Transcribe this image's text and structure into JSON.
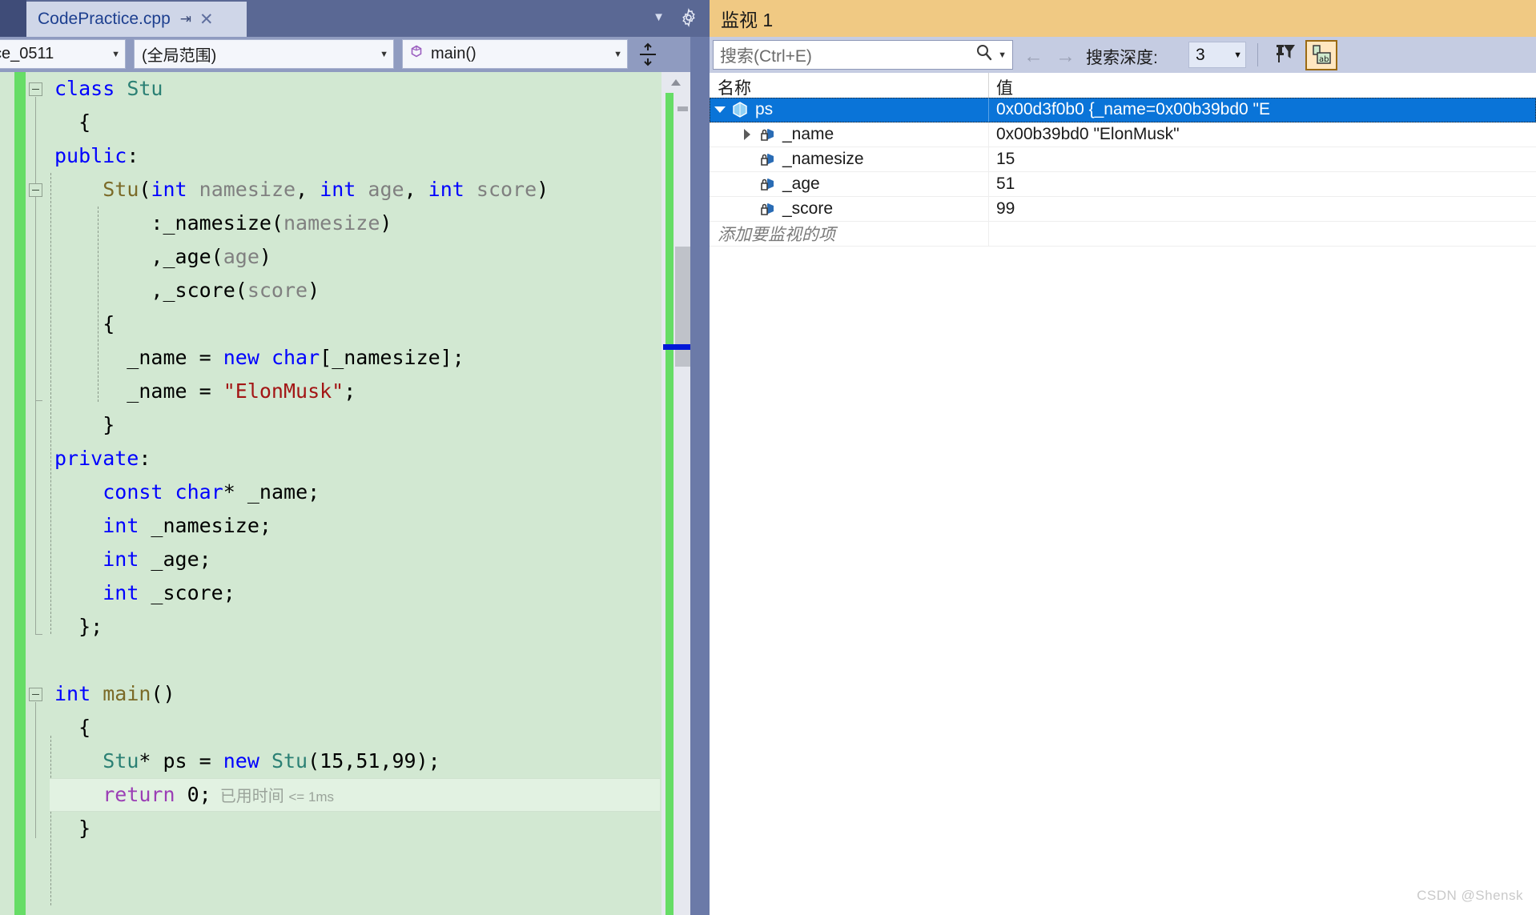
{
  "editor": {
    "tab": {
      "title": "CodePractice.cpp",
      "pin_icon": "pin-icon",
      "close_icon": "close-icon",
      "overflow_icon": "chevron-down-icon",
      "gear_icon": "gear-icon"
    },
    "navbar": {
      "project": "ce_0511",
      "scope": "(全局范围)",
      "member": "main()",
      "member_icon": "method-icon",
      "splitter_icon": "split-window-icon",
      "dropdown_arrow": "▾"
    },
    "code_lines": [
      {
        "tokens": [
          {
            "t": "class ",
            "c": "kw"
          },
          {
            "t": "Stu",
            "c": "type"
          }
        ]
      },
      {
        "tokens": [
          {
            "t": "  {",
            "c": "num"
          }
        ]
      },
      {
        "tokens": [
          {
            "t": "public",
            "c": "kw"
          },
          {
            "t": ":",
            "c": "num"
          }
        ]
      },
      {
        "tokens": [
          {
            "t": "    ",
            "c": "num"
          },
          {
            "t": "Stu",
            "c": "fn"
          },
          {
            "t": "(",
            "c": "num"
          },
          {
            "t": "int",
            "c": "kw"
          },
          {
            "t": " ",
            "c": "num"
          },
          {
            "t": "namesize",
            "c": "param"
          },
          {
            "t": ", ",
            "c": "num"
          },
          {
            "t": "int",
            "c": "kw"
          },
          {
            "t": " ",
            "c": "num"
          },
          {
            "t": "age",
            "c": "param"
          },
          {
            "t": ", ",
            "c": "num"
          },
          {
            "t": "int",
            "c": "kw"
          },
          {
            "t": " ",
            "c": "num"
          },
          {
            "t": "score",
            "c": "param"
          },
          {
            "t": ")",
            "c": "num"
          }
        ]
      },
      {
        "tokens": [
          {
            "t": "        :_namesize(",
            "c": "num"
          },
          {
            "t": "namesize",
            "c": "param"
          },
          {
            "t": ")",
            "c": "num"
          }
        ]
      },
      {
        "tokens": [
          {
            "t": "        ,_age(",
            "c": "num"
          },
          {
            "t": "age",
            "c": "param"
          },
          {
            "t": ")",
            "c": "num"
          }
        ]
      },
      {
        "tokens": [
          {
            "t": "        ,_score(",
            "c": "num"
          },
          {
            "t": "score",
            "c": "param"
          },
          {
            "t": ")",
            "c": "num"
          }
        ]
      },
      {
        "tokens": [
          {
            "t": "    {",
            "c": "num"
          }
        ]
      },
      {
        "tokens": [
          {
            "t": "      _name = ",
            "c": "num"
          },
          {
            "t": "new",
            "c": "kw"
          },
          {
            "t": " ",
            "c": "num"
          },
          {
            "t": "char",
            "c": "kw"
          },
          {
            "t": "[_namesize];",
            "c": "num"
          }
        ]
      },
      {
        "tokens": [
          {
            "t": "      _name = ",
            "c": "num"
          },
          {
            "t": "\"ElonMusk\"",
            "c": "str"
          },
          {
            "t": ";",
            "c": "num"
          }
        ]
      },
      {
        "tokens": [
          {
            "t": "    }",
            "c": "num"
          }
        ]
      },
      {
        "tokens": [
          {
            "t": "private",
            "c": "kw"
          },
          {
            "t": ":",
            "c": "num"
          }
        ]
      },
      {
        "tokens": [
          {
            "t": "    ",
            "c": "num"
          },
          {
            "t": "const",
            "c": "kw"
          },
          {
            "t": " ",
            "c": "num"
          },
          {
            "t": "char",
            "c": "kw"
          },
          {
            "t": "* _name;",
            "c": "num"
          }
        ]
      },
      {
        "tokens": [
          {
            "t": "    ",
            "c": "num"
          },
          {
            "t": "int",
            "c": "kw"
          },
          {
            "t": " _namesize;",
            "c": "num"
          }
        ]
      },
      {
        "tokens": [
          {
            "t": "    ",
            "c": "num"
          },
          {
            "t": "int",
            "c": "kw"
          },
          {
            "t": " _age;",
            "c": "num"
          }
        ]
      },
      {
        "tokens": [
          {
            "t": "    ",
            "c": "num"
          },
          {
            "t": "int",
            "c": "kw"
          },
          {
            "t": " _score;",
            "c": "num"
          }
        ]
      },
      {
        "tokens": [
          {
            "t": "  };",
            "c": "num"
          }
        ]
      },
      {
        "tokens": []
      },
      {
        "tokens": [
          {
            "t": "int",
            "c": "kw"
          },
          {
            "t": " ",
            "c": "num"
          },
          {
            "t": "main",
            "c": "fn"
          },
          {
            "t": "()",
            "c": "num"
          }
        ]
      },
      {
        "tokens": [
          {
            "t": "  {",
            "c": "num"
          }
        ]
      },
      {
        "tokens": [
          {
            "t": "    ",
            "c": "num"
          },
          {
            "t": "Stu",
            "c": "type"
          },
          {
            "t": "* ps = ",
            "c": "num"
          },
          {
            "t": "new",
            "c": "kw"
          },
          {
            "t": " ",
            "c": "num"
          },
          {
            "t": "Stu",
            "c": "type"
          },
          {
            "t": "(15,51,99);",
            "c": "num"
          }
        ]
      },
      {
        "current": true,
        "tokens": [
          {
            "t": "    ",
            "c": "num"
          },
          {
            "t": "return",
            "c": "ctrl"
          },
          {
            "t": " 0;",
            "c": "num"
          }
        ],
        "elapsed": "已用时间",
        "elapsed_value": "<= 1ms"
      },
      {
        "tokens": [
          {
            "t": "  }",
            "c": "num"
          }
        ]
      }
    ],
    "scrollbar": {
      "up_arrow_icon": "scroll-up-arrow-icon"
    }
  },
  "watch": {
    "title": "监视 1",
    "search_placeholder": "搜索(Ctrl+E)",
    "search_icon": "search-icon",
    "search_dropdown_arrow": "▾",
    "back_arrow": "←",
    "forward_arrow": "→",
    "depth_label": "搜索深度:",
    "depth_value": "3",
    "depth_arrow": "▾",
    "filter_icon": "pin-filter-icon",
    "hex_icon": "hex-display-icon",
    "columns": {
      "name": "名称",
      "value": "值"
    },
    "rows": [
      {
        "name": "ps",
        "value": "0x00d3f0b0 {_name=0x00b39bd0 \"E",
        "indent": 0,
        "expander": "open",
        "icon": "pointer-variable-icon",
        "selected": true
      },
      {
        "name": "_name",
        "value": "0x00b39bd0 \"ElonMusk\"",
        "indent": 1,
        "expander": "closed",
        "icon": "private-field-icon",
        "selected": false
      },
      {
        "name": "_namesize",
        "value": "15",
        "indent": 1,
        "expander": "none",
        "icon": "private-field-icon",
        "selected": false
      },
      {
        "name": "_age",
        "value": "51",
        "indent": 1,
        "expander": "none",
        "icon": "private-field-icon",
        "selected": false
      },
      {
        "name": "_score",
        "value": "99",
        "indent": 1,
        "expander": "none",
        "icon": "private-field-icon",
        "selected": false
      }
    ],
    "add_row_placeholder": "添加要监视的项"
  },
  "watermark": "CSDN @Shensk"
}
